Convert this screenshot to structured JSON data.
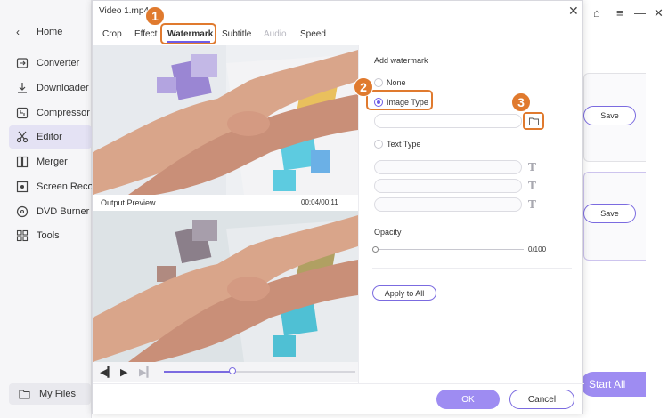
{
  "sidebar": {
    "home_label": "Home",
    "items": [
      {
        "label": "Converter",
        "icon": "converter-icon"
      },
      {
        "label": "Downloader",
        "icon": "downloader-icon"
      },
      {
        "label": "Compressor",
        "icon": "compressor-icon"
      },
      {
        "label": "Editor",
        "icon": "scissors-icon"
      },
      {
        "label": "Merger",
        "icon": "merger-icon"
      },
      {
        "label": "Screen Recorder",
        "icon": "screen-recorder-icon"
      },
      {
        "label": "DVD Burner",
        "icon": "dvd-icon"
      },
      {
        "label": "Tools",
        "icon": "tools-icon"
      }
    ],
    "active_index": 3,
    "my_files_label": "My Files"
  },
  "background": {
    "save_label": "Save",
    "start_all_label": "Start All"
  },
  "dialog": {
    "title": "Video 1.mp4",
    "tabs": [
      {
        "label": "Crop",
        "state": "normal"
      },
      {
        "label": "Effect",
        "state": "normal"
      },
      {
        "label": "Watermark",
        "state": "active"
      },
      {
        "label": "Subtitle",
        "state": "normal"
      },
      {
        "label": "Audio",
        "state": "disabled"
      },
      {
        "label": "Speed",
        "state": "normal"
      }
    ],
    "output_preview_label": "Output Preview",
    "time_readout": "00:04/00:11",
    "playback_progress": 0.36,
    "watermark": {
      "section_label": "Add watermark",
      "options": [
        "None",
        "Image Type",
        "Text Type"
      ],
      "selected": "Image Type",
      "image_path_value": "",
      "opacity_label": "Opacity",
      "opacity_value": "0/100",
      "apply_all_label": "Apply to All"
    },
    "ok_label": "OK",
    "cancel_label": "Cancel"
  },
  "annotations": {
    "step1": "1",
    "step2": "2",
    "step3": "3"
  },
  "colors": {
    "accent": "#6d5ce7",
    "button_fill": "#9e8cf2",
    "annotation": "#e07a2e"
  }
}
